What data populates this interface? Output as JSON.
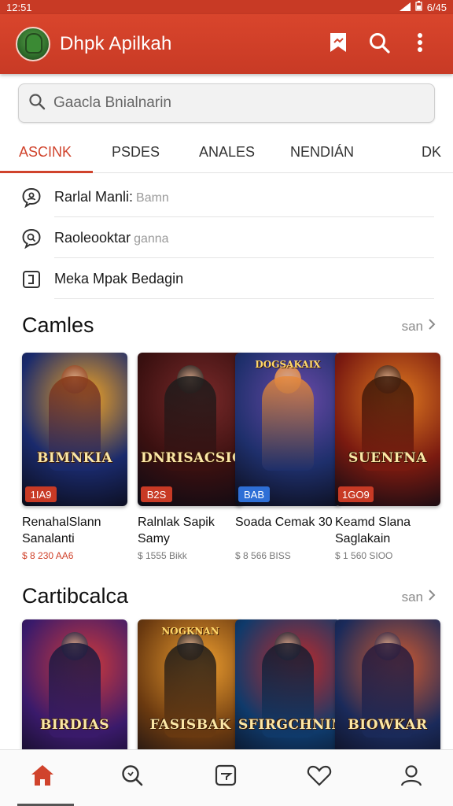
{
  "status_bar": {
    "time": "12:51",
    "battery": "6/45"
  },
  "app_bar": {
    "title": "Dhpk Apilkah",
    "actions": [
      {
        "icon": "bookmark-icon"
      },
      {
        "icon": "search-icon"
      },
      {
        "icon": "more-vert-icon"
      }
    ]
  },
  "search": {
    "placeholder": "Gaacla Bnialnarin"
  },
  "tabs": [
    {
      "label": "ASCINK",
      "active": true
    },
    {
      "label": "PSDES",
      "active": false
    },
    {
      "label": "ANALES",
      "active": false
    },
    {
      "label": "NENDIÁN",
      "active": false
    },
    {
      "label": "DK",
      "active": false
    }
  ],
  "suggestions": [
    {
      "text": "Rarlal Manli:",
      "sub": "Bamn",
      "icon": "chat-person-icon"
    },
    {
      "text": "Raoleooktar",
      "sub": "ganna",
      "icon": "chat-search-icon"
    },
    {
      "text": "Meka Mpak Bedagin",
      "sub": "",
      "icon": "square-bracket-icon"
    }
  ],
  "sections": [
    {
      "title": "Camles",
      "see_all": "san",
      "cards": [
        {
          "art_title": "BIMNKIA",
          "art_top": "",
          "price": "1IA9",
          "price_color": "#c83a25",
          "name": "RenahalSlann Sanalanti",
          "meta": "$ 8 230 AA6",
          "meta_accent": true,
          "palette": [
            "#1a2a6c",
            "#f5a623",
            "#8b3a16"
          ]
        },
        {
          "art_title": "DNRISACSION",
          "art_top": "",
          "price": "B2S",
          "price_color": "#c83a25",
          "name": "Ralnlak Sapik Samy",
          "meta": "$ 1555 Bikk",
          "meta_accent": false,
          "palette": [
            "#3a1010",
            "#7a2a2a",
            "#1c1c1c"
          ]
        },
        {
          "art_title": "",
          "art_top": "DOGSAKAIX",
          "price": "BAB",
          "price_color": "#2e6fd6",
          "name": "Soada Cemak 30",
          "meta": "$ 8 566 BISS",
          "meta_accent": false,
          "palette": [
            "#1e2f6b",
            "#6a4aa8",
            "#e8893a"
          ]
        },
        {
          "art_title": "SUENFNA",
          "art_top": "",
          "price": "1GO9",
          "price_color": "#c83a25",
          "name": "Keamd Slana Saglakain",
          "meta": "$ 1 560 SIOO",
          "meta_accent": false,
          "palette": [
            "#7a1a10",
            "#e07a20",
            "#3a1a08"
          ]
        }
      ]
    },
    {
      "title": "Cartibcalca",
      "see_all": "san",
      "cards": [
        {
          "art_title": "BIRDIAS",
          "art_top": "",
          "price": "",
          "price_color": "#c83a25",
          "name": "",
          "meta": "",
          "meta_accent": false,
          "palette": [
            "#3a1a6b",
            "#d23a3a",
            "#1a1a3a"
          ]
        },
        {
          "art_title": "FASISBAK",
          "art_top": "NOGKNAN",
          "price": "",
          "price_color": "#c83a25",
          "name": "",
          "meta": "",
          "meta_accent": false,
          "palette": [
            "#6b3a10",
            "#f0a030",
            "#1a1a1a"
          ]
        },
        {
          "art_title": "SFIRGCHNIN",
          "art_top": "",
          "price": "",
          "price_color": "#c83a25",
          "name": "",
          "meta": "",
          "meta_accent": false,
          "palette": [
            "#0f3a6b",
            "#c02a2a",
            "#1a1a2a"
          ]
        },
        {
          "art_title": "BIOWKAR",
          "art_top": "",
          "price": "",
          "price_color": "#c83a25",
          "name": "",
          "meta": "",
          "meta_accent": false,
          "palette": [
            "#1a2a5a",
            "#d05a30",
            "#2a1a3a"
          ]
        }
      ]
    }
  ],
  "bottom_nav": [
    {
      "icon": "home-icon",
      "active": true
    },
    {
      "icon": "search-icon",
      "active": false
    },
    {
      "icon": "store-icon",
      "active": false
    },
    {
      "icon": "heart-icon",
      "active": false
    },
    {
      "icon": "profile-icon",
      "active": false
    }
  ],
  "colors": {
    "accent": "#d0432c",
    "app_bar": "#c83a25"
  }
}
